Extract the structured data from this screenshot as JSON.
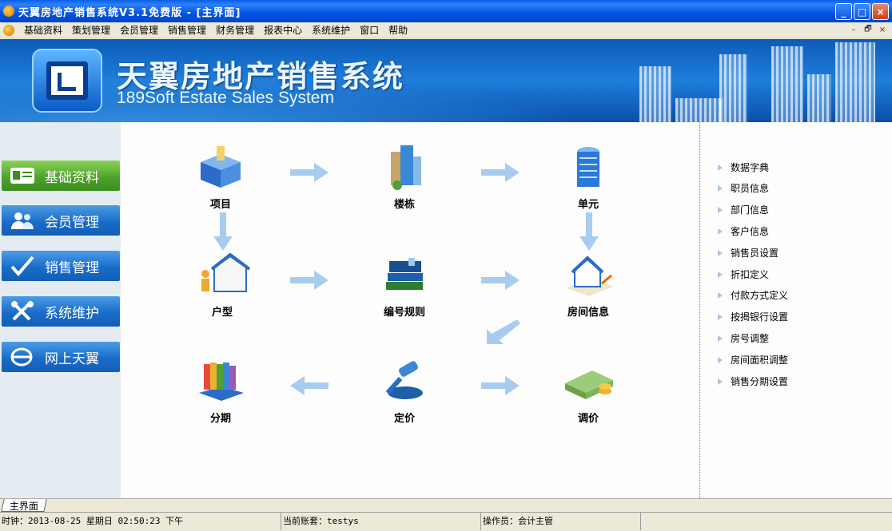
{
  "window": {
    "title": "天翼房地产销售系统V3.1免费版 - [主界面]",
    "controls": {
      "minimize": "_",
      "maximize": "□",
      "close": "×"
    }
  },
  "menu": {
    "items": [
      "基础资料",
      "策划管理",
      "会员管理",
      "销售管理",
      "财务管理",
      "报表中心",
      "系统维护",
      "窗口",
      "帮助"
    ],
    "mdi_controls": [
      "–",
      "🗗",
      "×"
    ]
  },
  "banner": {
    "title": "天翼房地产销售系统",
    "subtitle": "189Soft Estate Sales System"
  },
  "sidebar": {
    "items": [
      {
        "label": "基础资料",
        "icon": "id-card-icon",
        "active": true
      },
      {
        "label": "会员管理",
        "icon": "users-icon",
        "active": false
      },
      {
        "label": "销售管理",
        "icon": "checkmark-icon",
        "active": false
      },
      {
        "label": "系统维护",
        "icon": "tools-icon",
        "active": false
      },
      {
        "label": "网上天翼",
        "icon": "internet-icon",
        "active": false
      }
    ]
  },
  "flow": {
    "items": [
      {
        "label": "项目",
        "icon": "project-box-icon"
      },
      {
        "label": "楼栋",
        "icon": "buildings-icon"
      },
      {
        "label": "单元",
        "icon": "tower-icon"
      },
      {
        "label": "户型",
        "icon": "house-people-icon"
      },
      {
        "label": "编号规则",
        "icon": "books-icon"
      },
      {
        "label": "房间信息",
        "icon": "house-blueprint-icon"
      },
      {
        "label": "分期",
        "icon": "book-stack-icon"
      },
      {
        "label": "定价",
        "icon": "gavel-icon"
      },
      {
        "label": "调价",
        "icon": "money-icon"
      }
    ]
  },
  "right_panel": {
    "links": [
      "数据字典",
      "职员信息",
      "部门信息",
      "客户信息",
      "销售员设置",
      "折扣定义",
      "付款方式定义",
      "按揭银行设置",
      "房号调整",
      "房间面积调整",
      "销售分期设置"
    ]
  },
  "tabs": {
    "active": "主界面"
  },
  "status": {
    "clock": "时钟：2013-08-25 星期日 02:50:23 下午",
    "account": "当前账套：testys",
    "operator": "操作员：会计主管"
  },
  "colors": {
    "accent_blue": "#1A6CC8",
    "active_green": "#4DA42A",
    "banner_blue": "#0D5BB8"
  }
}
